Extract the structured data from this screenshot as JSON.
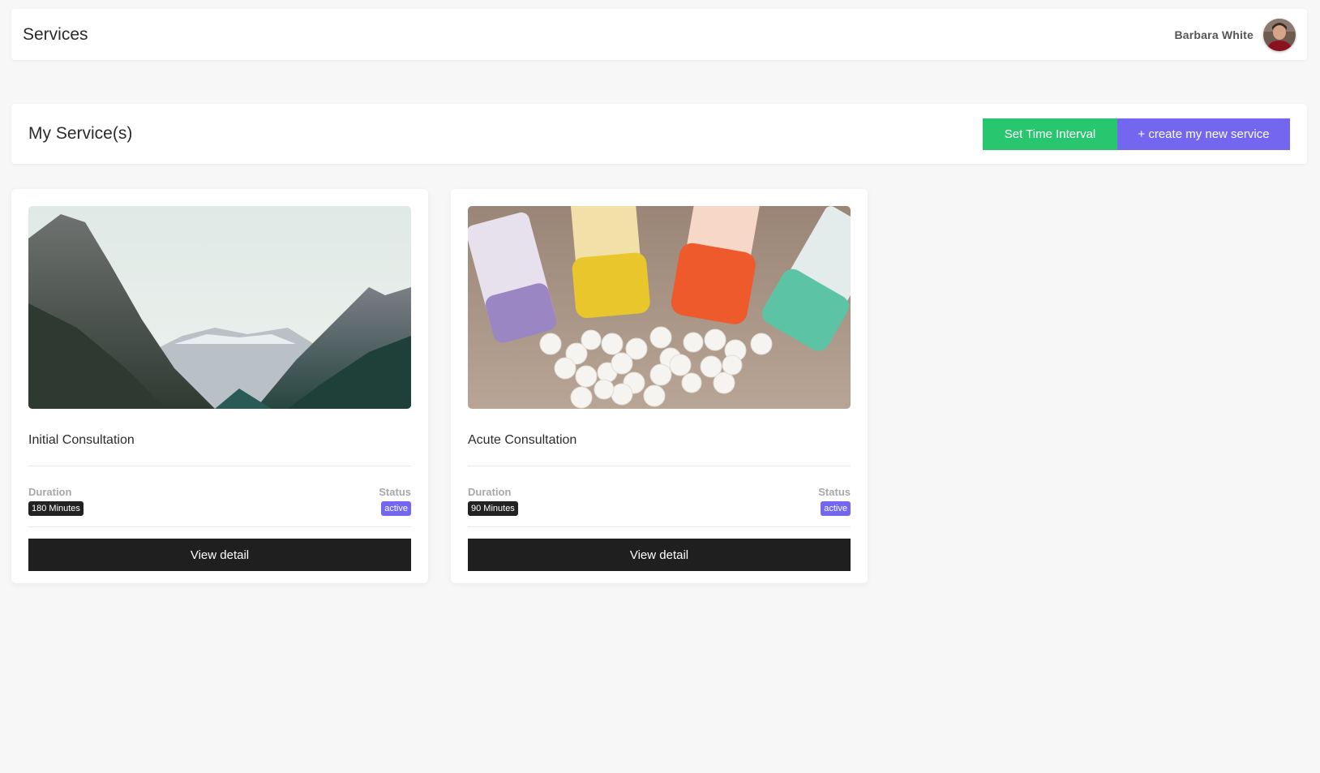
{
  "topbar": {
    "title": "Services",
    "user_name": "Barbara White"
  },
  "header": {
    "heading": "My Service(s)",
    "set_time_interval_label": "Set Time Interval",
    "create_service_label": "+ create my new service"
  },
  "services": [
    {
      "title": "Initial Consultation",
      "image": "mountain-landscape-photo",
      "duration_label": "Duration",
      "duration": "180 Minutes",
      "status_label": "Status",
      "status": "active",
      "button_label": "View detail"
    },
    {
      "title": "Acute Consultation",
      "image": "homeopathic-pill-bottles-photo",
      "duration_label": "Duration",
      "duration": "90 Minutes",
      "status_label": "Status",
      "status": "active",
      "button_label": "View detail"
    }
  ],
  "colors": {
    "green": "#28c76f",
    "purple": "#7367f0",
    "dark": "#1f1f1f"
  }
}
